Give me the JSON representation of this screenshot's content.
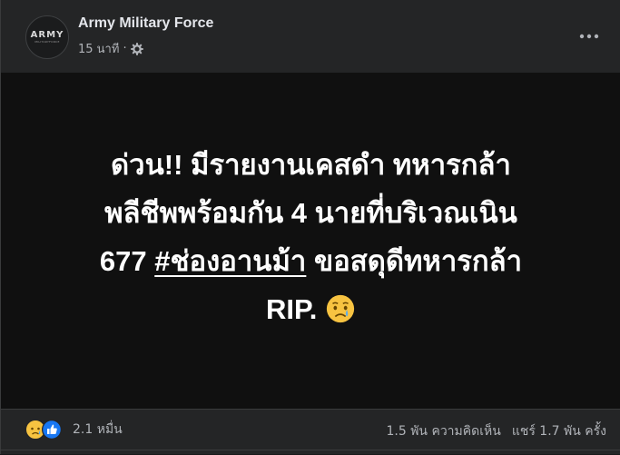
{
  "page": {
    "name": "Army Military Force",
    "avatar_logo": "ARMY",
    "avatar_sub": "MILITARYFORCE",
    "time_ago": "15 นาที",
    "dot": "·"
  },
  "post": {
    "line1": "ด่วน!! มีรายงานเคสดำ ทหารกล้า",
    "line2": "พลีชีพพร้อมกัน 4 นายที่บริเวณเนิน",
    "line3_pre": "677 ",
    "hashtag": "#ช่องอานม้า",
    "line3_post": " ขอสดุดีทหารกล้า",
    "line4": "RIP. "
  },
  "footer": {
    "reaction_count": "2.1 หมื่น",
    "comments": "1.5 พัน ความคิดเห็น",
    "shares": "แชร์ 1.7 พัน ครั้ง"
  },
  "colors": {
    "card_bg": "#242526",
    "post_bg": "#101010",
    "text_primary": "#e4e6eb",
    "text_secondary": "#b0b3b8",
    "like_blue": "#1877f2",
    "sad_yellow": "#f7c341"
  },
  "icons": {
    "settings": "gear-icon",
    "more": "more-options-icon",
    "sad": "sad-reaction-icon",
    "like": "like-reaction-icon",
    "emoji": "crying-face-emoji"
  }
}
